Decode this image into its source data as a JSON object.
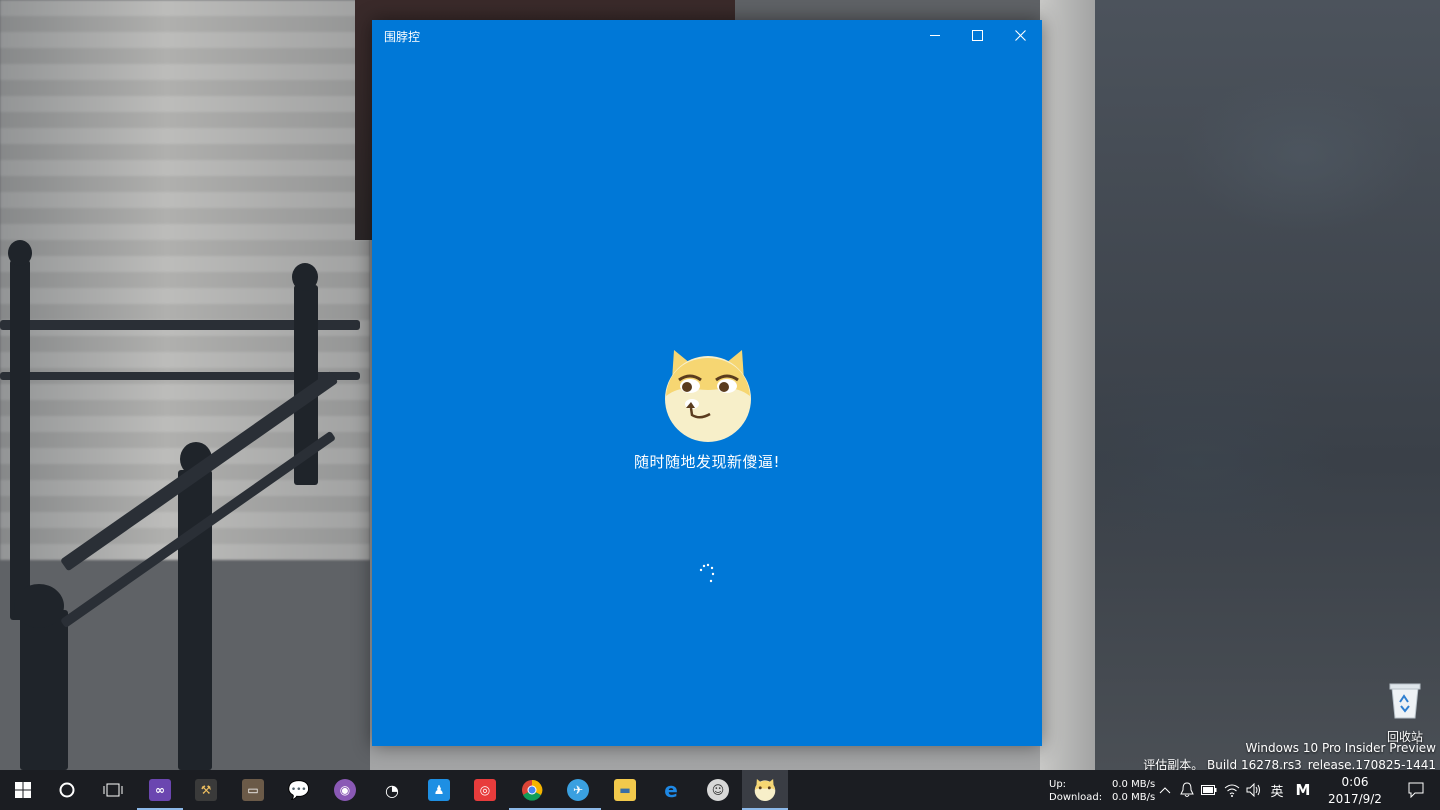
{
  "window": {
    "title": "围脖控",
    "splash_text": "随时随地发现新傻逼!"
  },
  "desktop": {
    "recycle_bin_label": "回收站",
    "watermark_line1": "Windows 10 Pro Insider Preview",
    "watermark_line2": "评估副本。 Build 16278.rs3_release.170825-1441"
  },
  "taskbar": {
    "apps": [
      {
        "name": "start-button",
        "icon": "windows-logo-icon"
      },
      {
        "name": "cortana-button",
        "icon": "cortana-circle-icon"
      },
      {
        "name": "task-view-button",
        "icon": "task-view-icon"
      },
      {
        "name": "visual-studio",
        "icon": "visual-studio-icon",
        "color": "#865fc5"
      },
      {
        "name": "dev-tools",
        "icon": "tools-icon",
        "color": "#c9a15a"
      },
      {
        "name": "terminal",
        "icon": "terminal-icon",
        "color": "#555555"
      },
      {
        "name": "wechat",
        "icon": "wechat-icon",
        "color": "#2dc100"
      },
      {
        "name": "github",
        "icon": "github-icon",
        "color": "#8a59b5"
      },
      {
        "name": "weibo",
        "icon": "weibo-icon",
        "color": "#ffffff"
      },
      {
        "name": "qq",
        "icon": "qq-icon",
        "color": "#1e8fe3"
      },
      {
        "name": "netease-music",
        "icon": "music-icon",
        "color": "#e83c3c"
      },
      {
        "name": "chrome",
        "icon": "chrome-icon",
        "color": "#4285f4"
      },
      {
        "name": "sublime-browser",
        "icon": "globe-icon",
        "color": "#3aa0e0"
      },
      {
        "name": "file-explorer",
        "icon": "folder-icon",
        "color": "#f2c94c"
      },
      {
        "name": "edge",
        "icon": "edge-icon",
        "color": "#1e88e5"
      },
      {
        "name": "avatar-app",
        "icon": "avatar-icon",
        "color": "#cccccc"
      },
      {
        "name": "weibo-app",
        "icon": "doge-icon",
        "color": "#f5d36a"
      }
    ],
    "network": {
      "up_label": "Up:",
      "down_label": "Download:",
      "up_value": "0.0 MB/s",
      "down_value": "0.0 MB/s"
    },
    "ime_label": "英",
    "ime_mode": "M",
    "time": "0:06",
    "date": "2017/9/2"
  }
}
